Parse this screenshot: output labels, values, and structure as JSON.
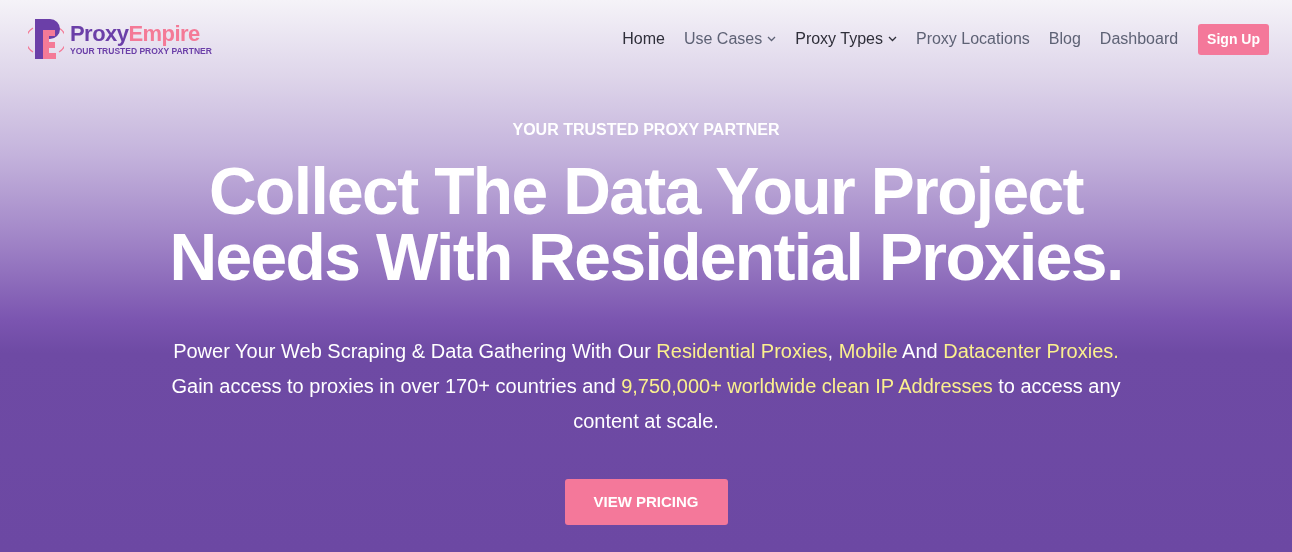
{
  "logo": {
    "name_part_1": "Proxy",
    "name_part_2": "Empire",
    "tagline": "YOUR TRUSTED PROXY PARTNER"
  },
  "nav": [
    {
      "label": "Home",
      "highlighted": true,
      "dropdown": false
    },
    {
      "label": "Use Cases",
      "highlighted": false,
      "dropdown": true
    },
    {
      "label": "Proxy Types",
      "highlighted": true,
      "dropdown": true
    },
    {
      "label": "Proxy Locations",
      "highlighted": false,
      "dropdown": false
    },
    {
      "label": "Blog",
      "highlighted": false,
      "dropdown": false
    },
    {
      "label": "Dashboard",
      "highlighted": false,
      "dropdown": false
    }
  ],
  "signup_button": "Sign Up",
  "hero": {
    "eyebrow": "YOUR TRUSTED PROXY PARTNER",
    "title_lines": [
      "Collect The Data Your Project",
      "Needs With Residential Proxies."
    ],
    "paragraph_lines": [
      [
        {
          "text": "Power Your Web Scraping & Data Gathering With Our ",
          "link": false
        },
        {
          "text": "Residential Proxies",
          "link": true
        },
        {
          "text": ", ",
          "link": false
        },
        {
          "text": "Mobile",
          "link": true
        },
        {
          "text": " And ",
          "link": false
        },
        {
          "text": "Datacenter Proxies.",
          "link": true
        }
      ],
      [
        {
          "text": "Gain access to proxies in over 170+ countries and ",
          "link": false
        },
        {
          "text": "9,750,000+ worldwide clean IP Addresses",
          "link": true
        },
        {
          "text": " to access any content at scale.",
          "link": false
        }
      ]
    ],
    "cta": "VIEW PRICING"
  }
}
